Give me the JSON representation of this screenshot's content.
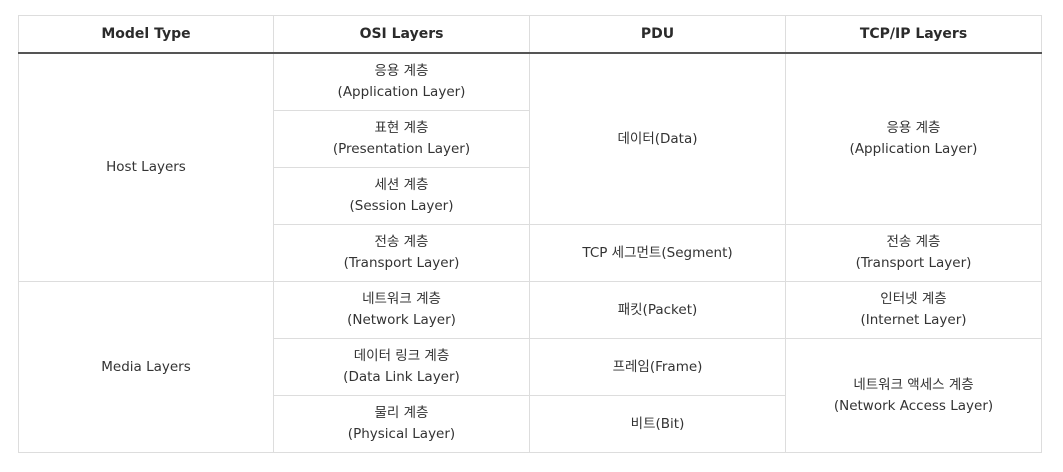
{
  "table": {
    "headers": {
      "model_type": "Model Type",
      "osi": "OSI Layers",
      "pdu": "PDU",
      "tcpip": "TCP/IP Layers"
    },
    "model_types": {
      "host": "Host Layers",
      "media": "Media Layers"
    },
    "osi": [
      {
        "ko": "응용 계층",
        "en": "(Application Layer)"
      },
      {
        "ko": "표현 계층",
        "en": "(Presentation Layer)"
      },
      {
        "ko": "세션 계층",
        "en": "(Session Layer)"
      },
      {
        "ko": "전송 계층",
        "en": "(Transport Layer)"
      },
      {
        "ko": "네트워크 계층",
        "en": "(Network Layer)"
      },
      {
        "ko": "데이터 링크 계층",
        "en": "(Data Link Layer)"
      },
      {
        "ko": "물리 계층",
        "en": "(Physical Layer)"
      }
    ],
    "pdu": {
      "data": "데이터(Data)",
      "segment": "TCP 세그먼트(Segment)",
      "packet": "패킷(Packet)",
      "frame": "프레임(Frame)",
      "bit": "비트(Bit)"
    },
    "tcpip": {
      "application": {
        "ko": "응용 계층",
        "en": "(Application Layer)"
      },
      "transport": {
        "ko": "전송 계층",
        "en": "(Transport Layer)"
      },
      "internet": {
        "ko": "인터넷 계층",
        "en": "(Internet Layer)"
      },
      "network_access": {
        "ko": "네트워크 액세스 계층",
        "en": "(Network Access Layer)"
      }
    }
  }
}
